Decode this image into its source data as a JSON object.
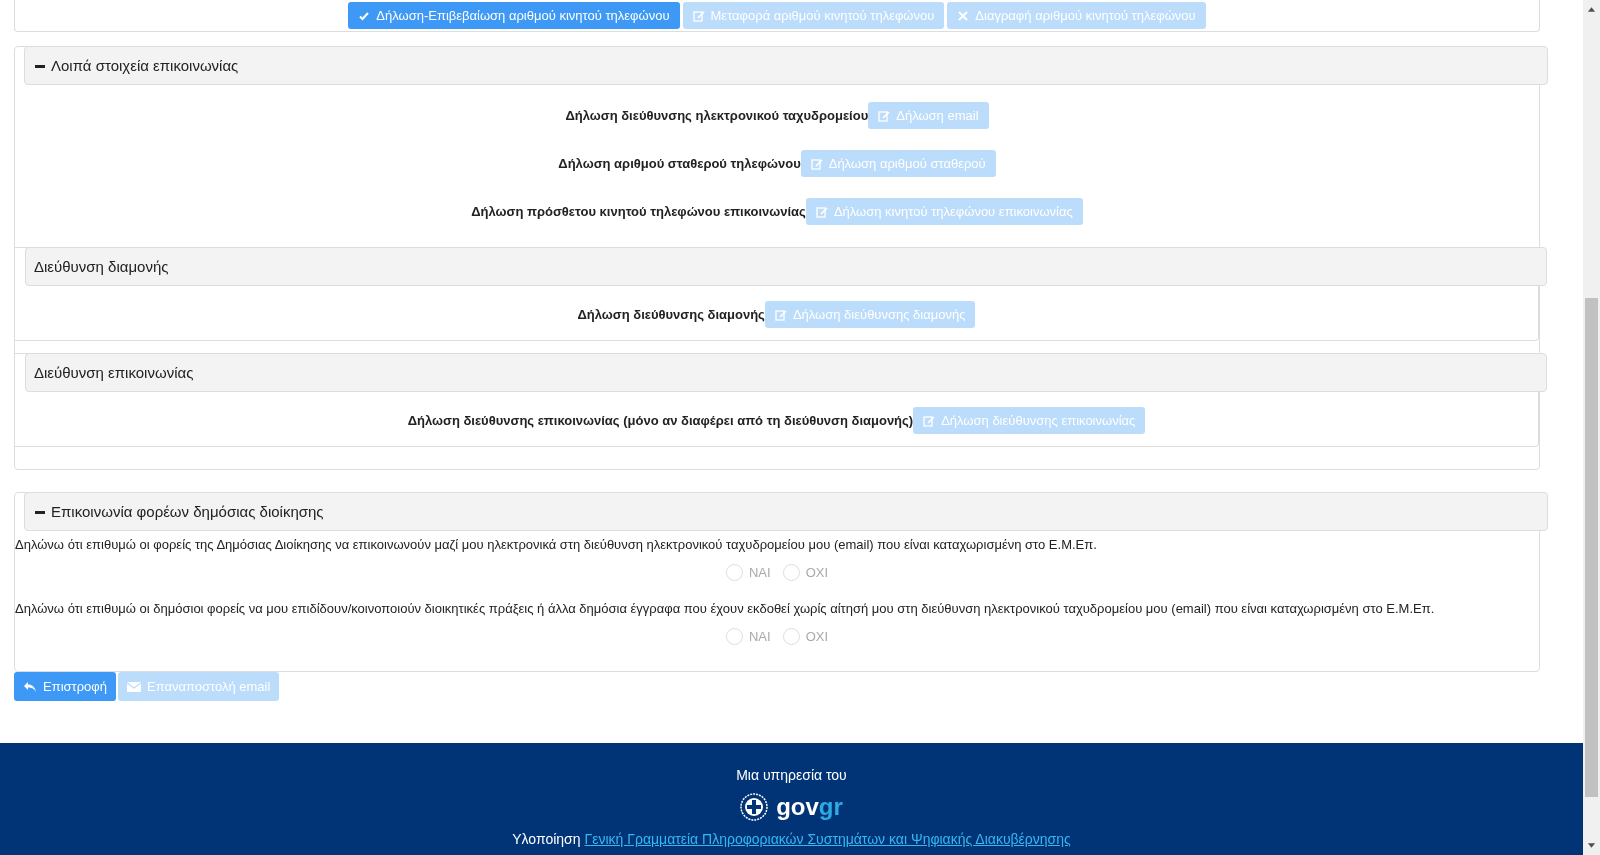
{
  "top_buttons": [
    {
      "label": "Δήλωση-Επιβεβαίωση αριθμού κινητού τηλεφώνου",
      "kind": "check",
      "disabled": false
    },
    {
      "label": "Μεταφορά αριθμού κινητού τηλεφώνου",
      "kind": "edit",
      "disabled": true
    },
    {
      "label": "Διαγραφή αριθμού κινητού τηλεφώνου",
      "kind": "close",
      "disabled": true
    }
  ],
  "other_contact": {
    "title": "Λοιπά στοιχεία επικοινωνίας",
    "expanded": true,
    "rows": [
      {
        "label": "Δήλωση διεύθυνσης ηλεκτρονικού ταχυδρομείου",
        "button": {
          "label": "Δήλωση email",
          "disabled": true
        }
      },
      {
        "label": "Δήλωση αριθμού σταθερού τηλεφώνου",
        "button": {
          "label": "Δήλωση αριθμού σταθερού",
          "disabled": true
        }
      },
      {
        "label": "Δήλωση πρόσθετου κινητού τηλεφώνου επικοινωνίας",
        "button": {
          "label": "Δήλωση κινητού τηλεφώνου επικοινωνίας",
          "disabled": true
        }
      }
    ],
    "subpanels": [
      {
        "title": "Διεύθυνση διαμονής",
        "rows": [
          {
            "label": "Δήλωση διεύθυνσης διαμονής",
            "button": {
              "label": "Δήλωση διεύθυνσης διαμονής",
              "disabled": true
            }
          }
        ]
      },
      {
        "title": "Διεύθυνση επικοινωνίας",
        "rows": [
          {
            "label": "Δήλωση διεύθυνσης επικοινωνίας (μόνο αν διαφέρει από τη διεύθυνση διαμονής)",
            "button": {
              "label": "Δήλωση διεύθυνσης επικοινωνίας",
              "disabled": true
            }
          }
        ]
      }
    ]
  },
  "public_admin": {
    "title": "Επικοινωνία φορέων δημόσιας διοίκησης",
    "expanded": true,
    "questions": [
      {
        "text": "Δηλώνω ότι επιθυμώ οι φορείς της Δημόσιας Διοίκησης να επικοινωνούν μαζί μου ηλεκτρονικά στη διεύθυνση ηλεκτρονικού ταχυδρομείου μου (email) που είναι καταχωρισμένη στο Ε.Μ.Επ.",
        "options": [
          {
            "label": "ΝΑΙ",
            "checked": false,
            "disabled": true
          },
          {
            "label": "ΟΧΙ",
            "checked": false,
            "disabled": true
          }
        ]
      },
      {
        "text": "Δηλώνω ότι επιθυμώ οι δημόσιοι φορείς να μου επιδίδουν/κοινοποιούν διοικητικές πράξεις ή άλλα δημόσια έγγραφα που έχουν εκδοθεί χωρίς αίτησή μου στη διεύθυνση ηλεκτρονικού ταχυδρομείου μου (email) που είναι καταχωρισμένη στο Ε.Μ.Επ.",
        "options": [
          {
            "label": "ΝΑΙ",
            "checked": false,
            "disabled": true
          },
          {
            "label": "ΟΧΙ",
            "checked": false,
            "disabled": true
          }
        ]
      }
    ]
  },
  "actions": [
    {
      "label": "Επιστροφή",
      "kind": "back",
      "disabled": false
    },
    {
      "label": "Επαναποστολή email",
      "kind": "email",
      "disabled": true
    }
  ],
  "footer": {
    "service_label": "Μια υπηρεσία του",
    "logo_part_1": "gov",
    "logo_part_2": "gr",
    "implementation_label": "Υλοποίηση",
    "implementation_link": "Γενική Γραμματεία Πληροφοριακών Συστημάτων και Ψηφιακής Διακυβέρνησης"
  }
}
